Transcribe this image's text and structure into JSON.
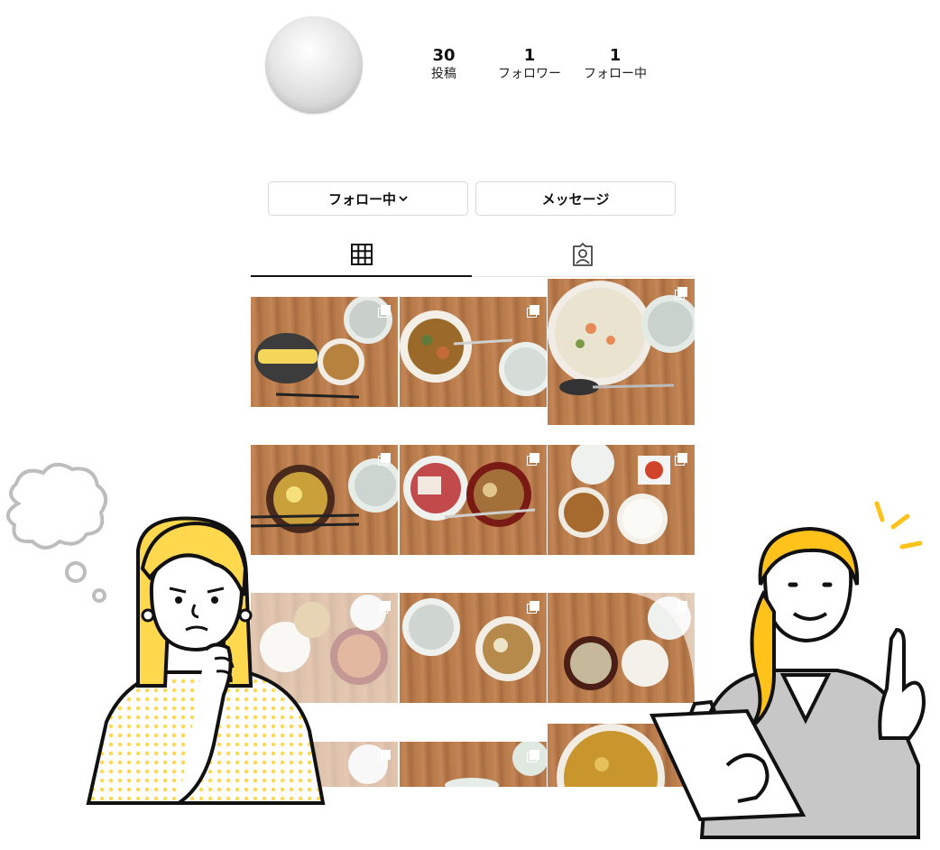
{
  "profile": {
    "stats": [
      {
        "count": "30",
        "label": "投稿"
      },
      {
        "count": "1",
        "label": "フォロワー"
      },
      {
        "count": "1",
        "label": "フォロー中"
      }
    ]
  },
  "actions": {
    "following_label": "フォロー中",
    "message_label": "メッセージ"
  },
  "tabs": [
    {
      "icon": "grid-icon",
      "active": true
    },
    {
      "icon": "tagged-user-icon",
      "active": false
    }
  ],
  "posts_visible": 12,
  "colors": {
    "avatar": "#cfcfcf",
    "wood": "#b97b4a",
    "accent_yellow": "#ffd84d",
    "line": "#111111"
  }
}
